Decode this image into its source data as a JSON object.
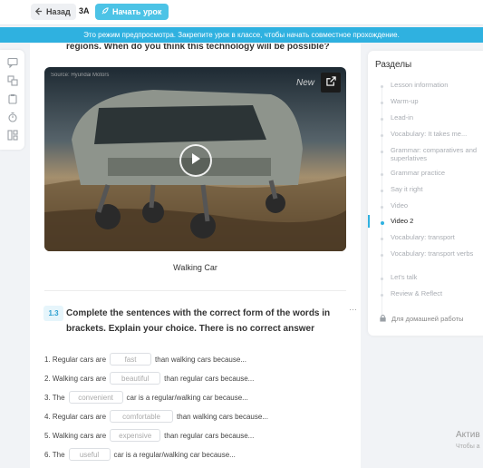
{
  "topbar": {
    "back_label": "Назад",
    "class_label": "3A",
    "start_label": "Начать урок"
  },
  "banner": {
    "text": "Это режим предпросмотра. Закрепите урок в классе, чтобы начать совместное прохождение."
  },
  "toolbar": {
    "icons": [
      "chat-icon",
      "translate-icon",
      "clipboard-icon",
      "timer-icon",
      "layout-icon"
    ]
  },
  "content": {
    "question_text": "regions. When do you think this technology will be possible?",
    "video": {
      "source_label": "Source: Hyundai Motors",
      "watermark": "New",
      "caption": "Walking Car"
    },
    "task": {
      "number": "1.3",
      "title": "Complete the sentences with the correct form of the words in brackets. Explain your choice. There is no correct answer",
      "menu": "···"
    },
    "sentences": [
      {
        "prefix": "1. Regular cars are",
        "blank": "fast",
        "suffix": "than walking cars because..."
      },
      {
        "prefix": "2. Walking cars are",
        "blank": "beautiful",
        "suffix": "than regular cars because..."
      },
      {
        "prefix": "3. The",
        "blank": "convenient",
        "suffix": "car is a regular/walking car because..."
      },
      {
        "prefix": "4. Regular cars are",
        "blank": "comfortable",
        "suffix": "than walking cars because..."
      },
      {
        "prefix": "5. Walking cars are",
        "blank": "expensive",
        "suffix": "than regular cars because..."
      },
      {
        "prefix": "6. The",
        "blank": "useful",
        "suffix": "car is a regular/walking car because..."
      }
    ]
  },
  "sections": {
    "title": "Разделы",
    "items": [
      {
        "label": "Lesson information",
        "active": false
      },
      {
        "label": "Warm-up",
        "active": false
      },
      {
        "label": "Lead-in",
        "active": false
      },
      {
        "label": "Vocabulary: It takes me...",
        "active": false
      },
      {
        "label": "Grammar: comparatives and superlatives",
        "active": false
      },
      {
        "label": "Grammar practice",
        "active": false
      },
      {
        "label": "Say it right",
        "active": false
      },
      {
        "label": "Video",
        "active": false
      },
      {
        "label": "Video 2",
        "active": true
      },
      {
        "label": "Vocabulary: transport",
        "active": false
      },
      {
        "label": "Vocabulary: transport verbs",
        "active": false
      },
      {
        "label": "Let's talk",
        "active": false
      },
      {
        "label": "Review & Reflect",
        "active": false
      }
    ],
    "homework_label": "Для домашней работы"
  },
  "watermark_os": {
    "title": "Актив",
    "subtitle": "Чтобы а"
  },
  "colors": {
    "accent": "#2fb1e0",
    "start_button": "#4cc3e6"
  }
}
